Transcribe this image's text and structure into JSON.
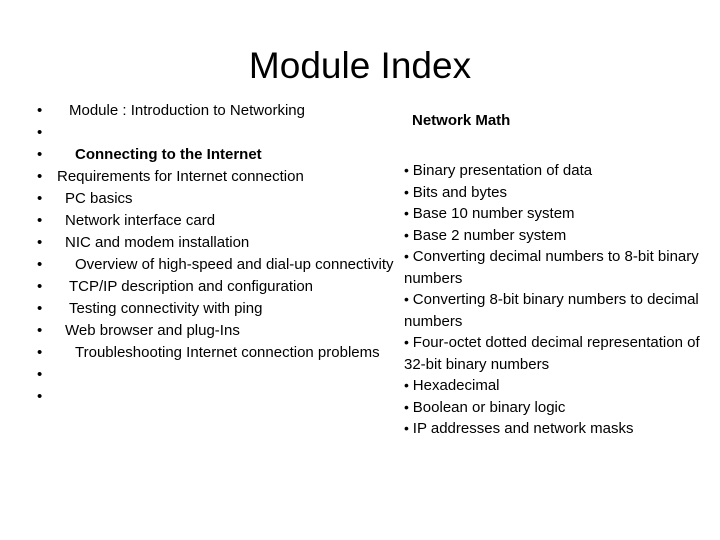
{
  "slide": {
    "title": "Module Index",
    "background_color": "#ffffff",
    "text_color": "#000000"
  },
  "left_column": {
    "bullet_glyph": "•",
    "items": [
      {
        "text": "Module : Introduction to Networking",
        "bold": false,
        "indent": 2,
        "empty": false
      },
      {
        "text": "",
        "bold": false,
        "indent": 0,
        "empty": true
      },
      {
        "text": "Connecting to the Internet",
        "bold": true,
        "indent": 3,
        "empty": false
      },
      {
        "text": "Requirements for Internet connection",
        "bold": false,
        "indent": 0,
        "empty": false
      },
      {
        "text": "PC basics",
        "bold": false,
        "indent": 1,
        "empty": false
      },
      {
        "text": "Network interface card",
        "bold": false,
        "indent": 1,
        "empty": false
      },
      {
        "text": "NIC and modem installation",
        "bold": false,
        "indent": 1,
        "empty": false
      },
      {
        "text": "Overview of high-speed and dial-up connectivity",
        "bold": false,
        "indent": 3,
        "empty": false
      },
      {
        "text": "TCP/IP description and configuration",
        "bold": false,
        "indent": 2,
        "empty": false
      },
      {
        "text": "Testing connectivity with ping",
        "bold": false,
        "indent": 2,
        "empty": false
      },
      {
        "text": "Web browser and plug-Ins",
        "bold": false,
        "indent": 1,
        "empty": false
      },
      {
        "text": "Troubleshooting Internet connection problems",
        "bold": false,
        "indent": 3,
        "empty": false
      },
      {
        "text": "",
        "bold": false,
        "indent": 0,
        "empty": true
      },
      {
        "text": "",
        "bold": false,
        "indent": 0,
        "empty": true
      }
    ]
  },
  "right_column": {
    "heading": "Network Math",
    "bullet_glyph": "•",
    "items": [
      {
        "text": "Binary presentation of data"
      },
      {
        "text": "Bits and bytes"
      },
      {
        "text": "Base 10 number system"
      },
      {
        "text": "Base 2 number system"
      },
      {
        "text": "Converting decimal numbers to 8-bit binary numbers"
      },
      {
        "text": "Converting 8-bit binary numbers to decimal numbers"
      },
      {
        "text": "Four-octet dotted decimal representation of 32-bit binary numbers"
      },
      {
        "text": "Hexadecimal"
      },
      {
        "text": "Boolean or binary logic"
      },
      {
        "text": "IP addresses and network masks"
      }
    ]
  }
}
